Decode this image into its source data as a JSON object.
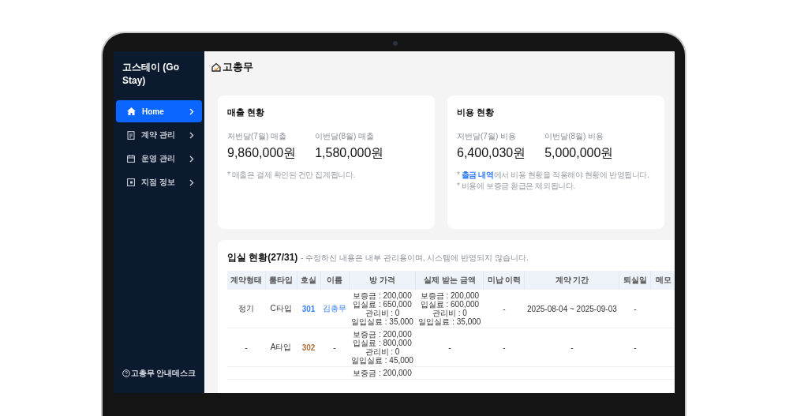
{
  "app": {
    "title": "고스테이 (Go Stay)"
  },
  "sidebar": {
    "items": [
      {
        "label": "Home",
        "selected": true
      },
      {
        "label": "계약 관리",
        "selected": false
      },
      {
        "label": "운영 관리",
        "selected": false
      },
      {
        "label": "지점 정보",
        "selected": false
      }
    ],
    "footer": "고총무 안내데스크"
  },
  "header": {
    "title": "고총무"
  },
  "cards": [
    {
      "title": "매출 현황",
      "stats": [
        {
          "label": "저번달(7월) 매출",
          "value": "9,860,000원"
        },
        {
          "label": "이번달(8월) 매출",
          "value": "1,580,000원"
        }
      ],
      "notes": [
        {
          "text": "* 매출은 결제 확인된 건만 집계됩니다."
        }
      ]
    },
    {
      "title": "비용 현황",
      "stats": [
        {
          "label": "저번달(7월) 비용",
          "value": "6,400,030원"
        },
        {
          "label": "이번달(8월) 비용",
          "value": "5,000,000원"
        }
      ],
      "notes": [
        {
          "prefix": "* ",
          "link": "출금 내역",
          "text": "에서 비용 현황을 적용해야 현황에 반영됩니다."
        },
        {
          "text": "* 비용에 보증금 환급은 제외됩니다."
        }
      ]
    }
  ],
  "occupancy": {
    "title": "입실 현황(27/31)",
    "note": "- 수정하신 내용은 내부 관리용이며, 시스템에 반영되지 않습니다.",
    "columns": [
      "계약형태",
      "룸타입",
      "호실",
      "이름",
      "방 가격",
      "실제 받는 금액",
      "미납 이력",
      "계약 기간",
      "퇴실일",
      "메모"
    ],
    "rows": [
      {
        "contract_type": "정기",
        "room_type": "C타입",
        "room": {
          "text": "301",
          "color": "#3b82f6"
        },
        "name": {
          "text": "김총무",
          "linked": true
        },
        "room_price": [
          "보증금 : 200,000",
          "입실료 : 650,000",
          "관리비 : 0",
          "일입실료 : 35,000"
        ],
        "actual_amount": [
          "보증금 : 200,000",
          "입실료 : 600,000",
          "관리비 : 0",
          "일입실료 : 35,000"
        ],
        "unpaid": "-",
        "period": "2025-08-04 ~ 2025-09-03",
        "checkout": "-"
      },
      {
        "contract_type": "-",
        "room_type": "A타입",
        "room": {
          "text": "302",
          "color": "#b0703a"
        },
        "name": {
          "text": "-",
          "linked": false
        },
        "room_price": [
          "보증금 : 200,000",
          "입실료 : 800,000",
          "관리비 : 0",
          "일입실료 : 45,000"
        ],
        "actual_amount": [
          "-"
        ],
        "unpaid": "-",
        "period": "-",
        "checkout": "-"
      },
      {
        "room_price": [
          "보증금 : 200,000"
        ]
      }
    ]
  }
}
